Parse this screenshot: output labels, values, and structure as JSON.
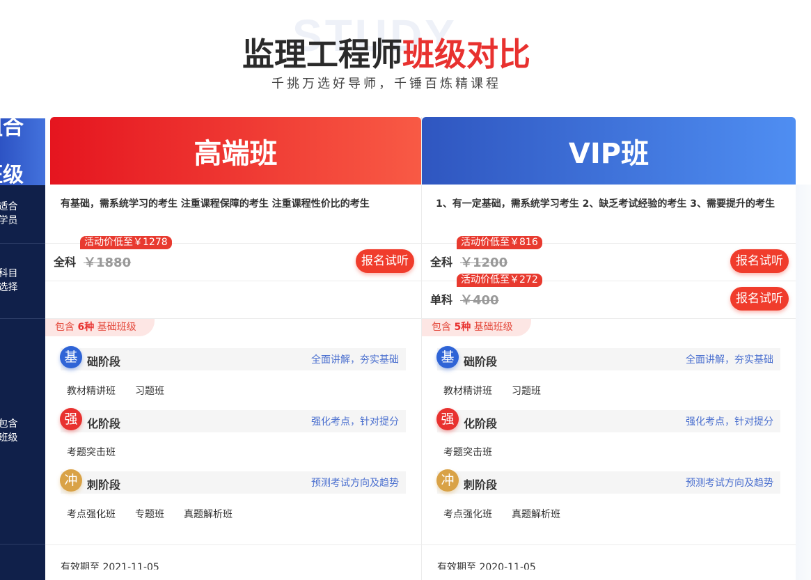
{
  "watermark": "STUDY",
  "header": {
    "title_part1": "监理工程师",
    "title_part2": "班级对比",
    "subtitle": "千挑万选好导师，千锤百炼精课程"
  },
  "sidebar": {
    "badge_line1": "组合",
    "badge_line2": "班级",
    "rows": [
      {
        "line1": "适合",
        "line2": "学员"
      },
      {
        "line1": "科目",
        "line2": "选择"
      },
      {
        "line1": "包含",
        "line2": "班级"
      }
    ]
  },
  "plans": [
    {
      "name": "高端班",
      "suitable": "有基础，需系统学习的考生 注重课程保障的考生 注重课程性价比的考生",
      "prices": [
        {
          "label": "全科",
          "original": "￥1880",
          "promo": "活动价低至￥1278",
          "button": "报名试听"
        }
      ],
      "include_prefix": "包含",
      "include_count": "6种",
      "include_suffix": "基础班级",
      "stages": [
        {
          "icon": "基",
          "name": "础阶段",
          "desc": "全面讲解，夯实基础",
          "classes": [
            "教材精讲班",
            "习题班"
          ]
        },
        {
          "icon": "强",
          "name": "化阶段",
          "desc": "强化考点，针对提分",
          "classes": [
            "考题突击班"
          ]
        },
        {
          "icon": "冲",
          "name": "刺阶段",
          "desc": "预测考试方向及趋势",
          "classes": [
            "考点强化班",
            "专题班",
            "真题解析班"
          ]
        }
      ],
      "validity": "有效期至 2021-11-05"
    },
    {
      "name": "VIP班",
      "suitable": "1、有一定基础，需系统学习考生 2、缺乏考试经验的考生 3、需要提升的考生",
      "prices": [
        {
          "label": "全科",
          "original": "￥1200",
          "promo": "活动价低至￥816",
          "button": "报名试听"
        },
        {
          "label": "单科",
          "original": "￥400",
          "promo": "活动价低至￥272",
          "button": "报名试听"
        }
      ],
      "include_prefix": "包含",
      "include_count": "5种",
      "include_suffix": "基础班级",
      "stages": [
        {
          "icon": "基",
          "name": "础阶段",
          "desc": "全面讲解，夯实基础",
          "classes": [
            "教材精讲班",
            "习题班"
          ]
        },
        {
          "icon": "强",
          "name": "化阶段",
          "desc": "强化考点，针对提分",
          "classes": [
            "考题突击班"
          ]
        },
        {
          "icon": "冲",
          "name": "刺阶段",
          "desc": "预测考试方向及趋势",
          "classes": [
            "考点强化班",
            "真题解析班"
          ]
        }
      ],
      "validity": "有效期至 2020-11-05"
    }
  ]
}
